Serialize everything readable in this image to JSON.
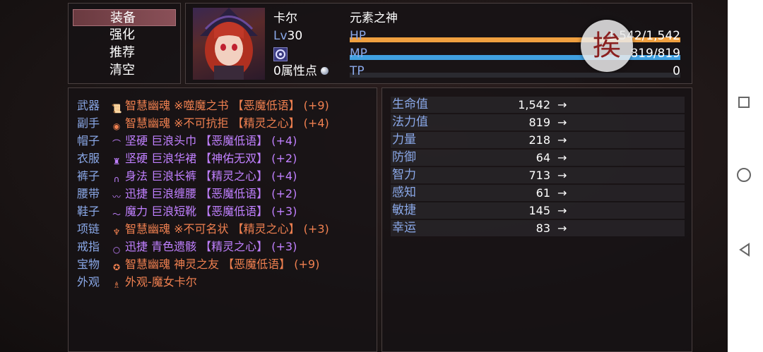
{
  "command_menu": {
    "items": [
      {
        "label": "装备",
        "selected": true
      },
      {
        "label": "强化",
        "selected": false
      },
      {
        "label": "推荐",
        "selected": false
      },
      {
        "label": "清空",
        "selected": false
      }
    ]
  },
  "actor": {
    "name": "卡尔",
    "class": "元素之神",
    "level_label": "Lv",
    "level": "30",
    "attribute_points": "0属性点",
    "hp": {
      "label": "HP",
      "text": "1,542/1,542",
      "fraction": 1.0,
      "color": "#f0a040"
    },
    "mp": {
      "label": "MP",
      "text": "819/819",
      "fraction": 1.0,
      "color": "#40a0e0"
    },
    "tp": {
      "label": "TP",
      "text": "0",
      "fraction": 0.0,
      "color": "#40c060"
    }
  },
  "stamp_glyph": "挨",
  "equipment": [
    {
      "slot": "武器",
      "icon": "book-icon",
      "glyph": "📜",
      "text": "智慧幽魂 ※噬魔之书 【恶魔低语】 (+9)",
      "tone": "orange"
    },
    {
      "slot": "副手",
      "icon": "orb-icon",
      "glyph": "◉",
      "text": "智慧幽魂 ※不可抗拒 【精灵之心】 (+4)",
      "tone": "orange"
    },
    {
      "slot": "帽子",
      "icon": "hat-icon",
      "glyph": "⌒",
      "text": "坚硬 巨浪头巾 【恶魔低语】 (+4)",
      "tone": "purple"
    },
    {
      "slot": "衣服",
      "icon": "robe-icon",
      "glyph": "♜",
      "text": "坚硬 巨浪华裙 【神佑无双】 (+2)",
      "tone": "purple"
    },
    {
      "slot": "裤子",
      "icon": "pants-icon",
      "glyph": "∩",
      "text": "身法 巨浪长裤 【精灵之心】 (+4)",
      "tone": "purple"
    },
    {
      "slot": "腰带",
      "icon": "belt-icon",
      "glyph": "〰",
      "text": "迅捷 巨浪缠腰 【恶魔低语】 (+2)",
      "tone": "purple"
    },
    {
      "slot": "鞋子",
      "icon": "boots-icon",
      "glyph": "〜",
      "text": "魔力 巨浪短靴 【恶魔低语】 (+3)",
      "tone": "purple"
    },
    {
      "slot": "项链",
      "icon": "necklace-icon",
      "glyph": "♆",
      "text": "智慧幽魂 ※不可名状 【精灵之心】 (+3)",
      "tone": "orange"
    },
    {
      "slot": "戒指",
      "icon": "ring-icon",
      "glyph": "○",
      "text": "迅捷 青色遗骸 【精灵之心】 (+3)",
      "tone": "purple"
    },
    {
      "slot": "宝物",
      "icon": "treasure-icon",
      "glyph": "✪",
      "text": "智慧幽魂 神灵之友 【恶魔低语】 (+9)",
      "tone": "orange"
    },
    {
      "slot": "外观",
      "icon": "costume-icon",
      "glyph": "♗",
      "text": "外观-魔女卡尔",
      "tone": "orange"
    }
  ],
  "params": [
    {
      "name": "生命值",
      "value": "1,542",
      "arrow": "→"
    },
    {
      "name": "法力值",
      "value": "819",
      "arrow": "→"
    },
    {
      "name": "力量",
      "value": "218",
      "arrow": "→"
    },
    {
      "name": "防御",
      "value": "64",
      "arrow": "→"
    },
    {
      "name": "智力",
      "value": "713",
      "arrow": "→"
    },
    {
      "name": "感知",
      "value": "61",
      "arrow": "→"
    },
    {
      "name": "敏捷",
      "value": "145",
      "arrow": "→"
    },
    {
      "name": "幸运",
      "value": "83",
      "arrow": "→"
    }
  ]
}
